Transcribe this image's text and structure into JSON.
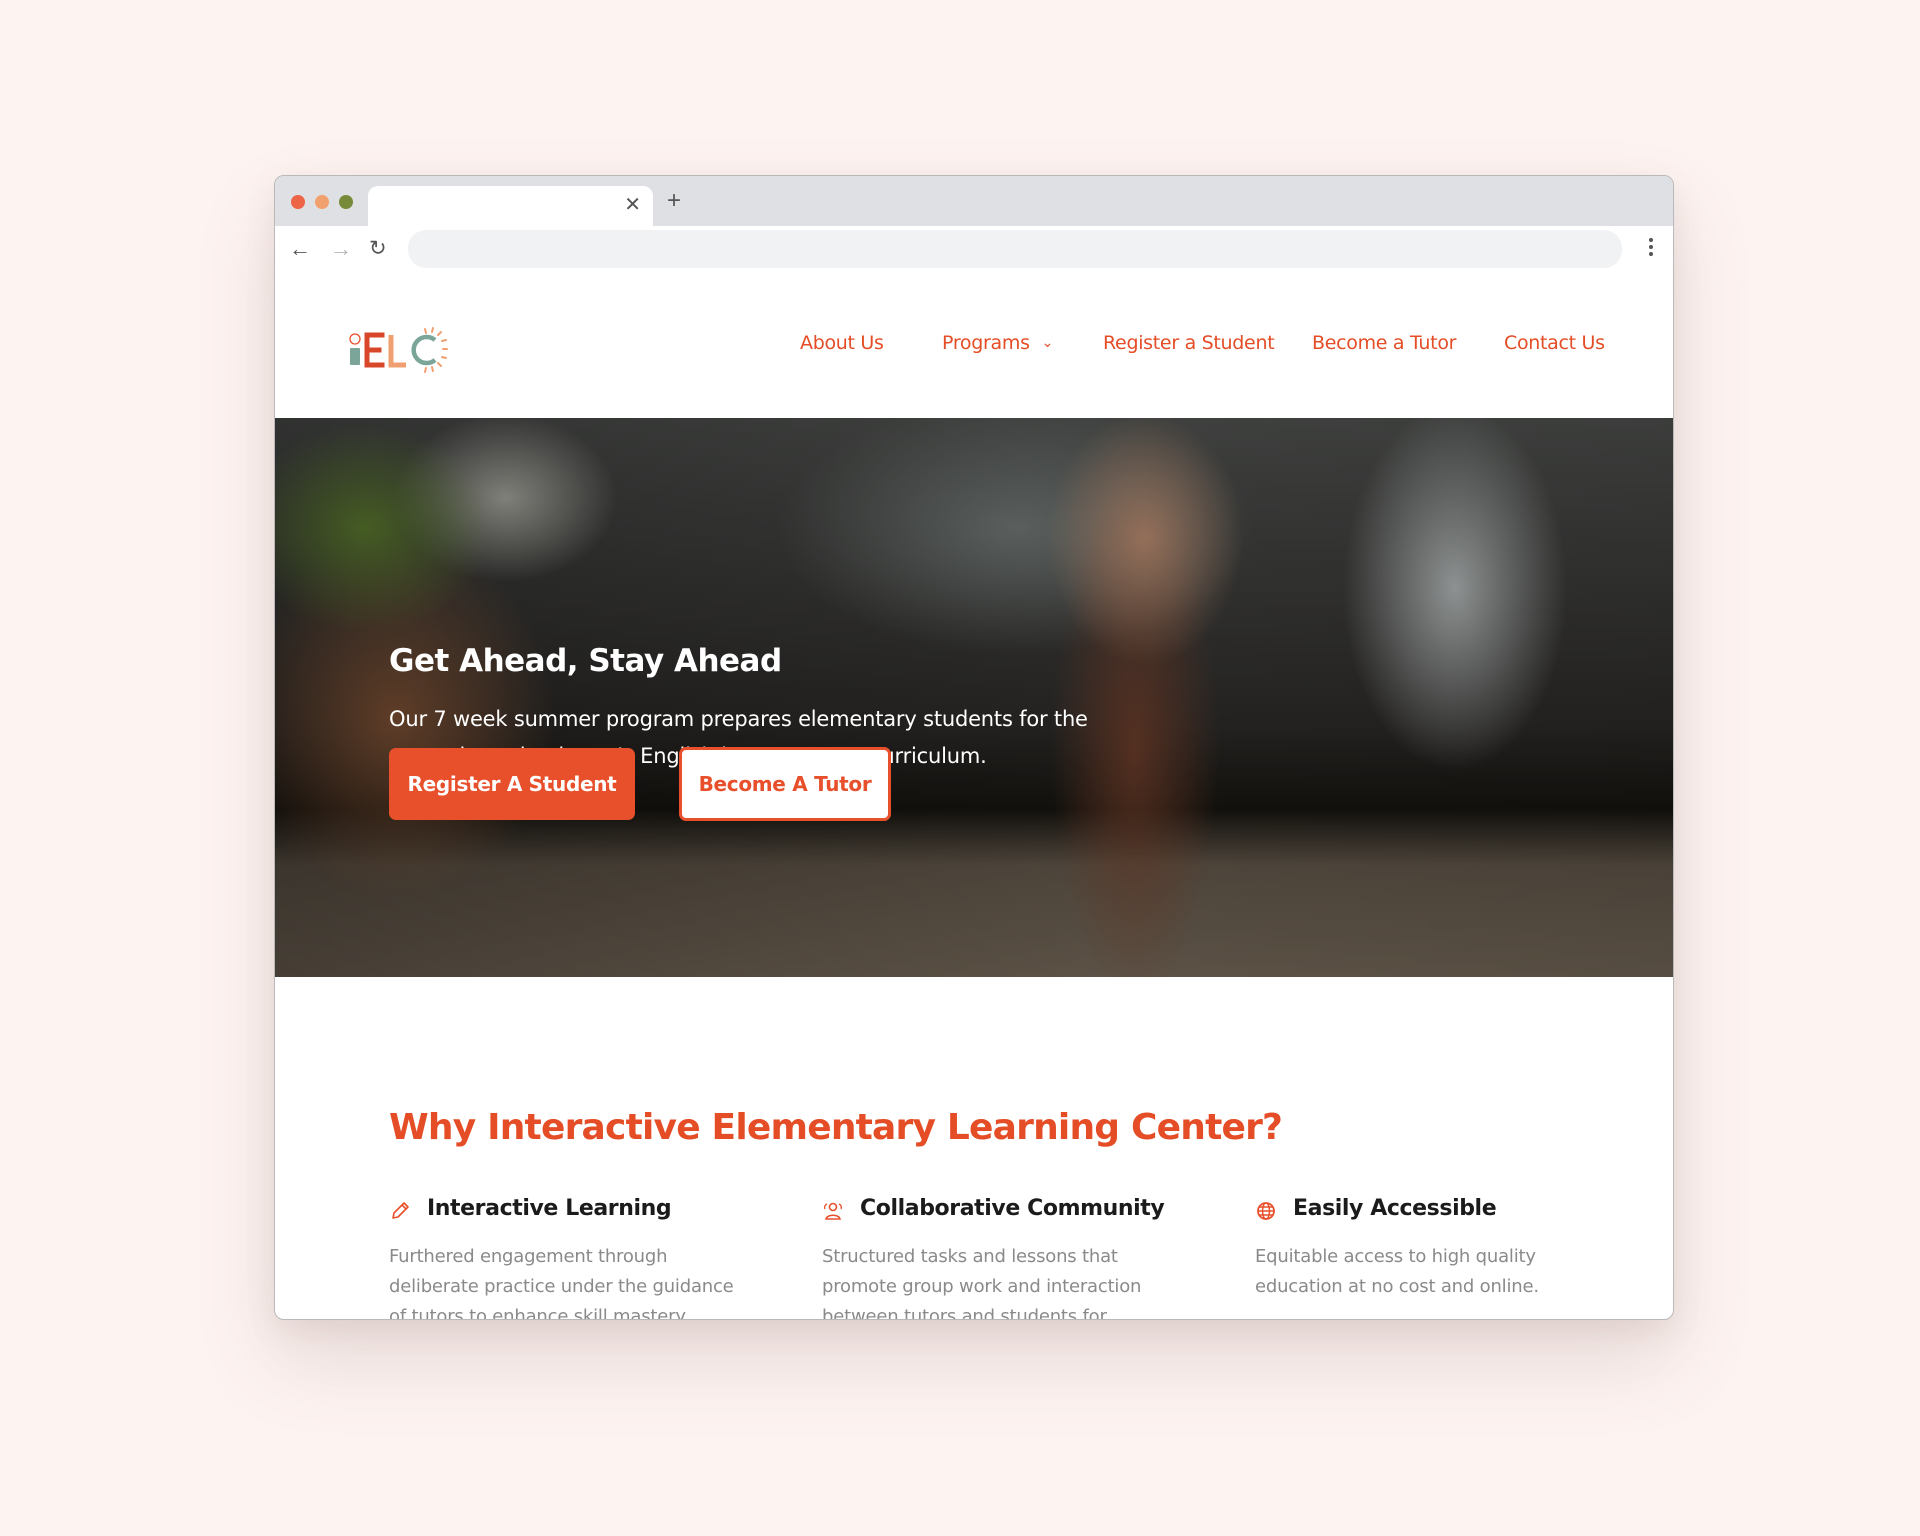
{
  "browser": {
    "tab": {
      "title": "",
      "close_icon": "close-icon"
    },
    "new_tab_icon": "plus-icon",
    "nav": {
      "back_icon": "arrow-left-icon",
      "forward_icon": "arrow-right-icon",
      "reload_icon": "reload-icon"
    },
    "address_bar": {
      "value": "",
      "placeholder": ""
    },
    "menu_icon": "kebab-menu-icon",
    "window_controls": [
      "close",
      "minimize",
      "maximize"
    ]
  },
  "site": {
    "logo": {
      "text": "iELC",
      "alt": "Interactive Elementary Learning Center logo"
    },
    "nav": [
      {
        "label": "About Us"
      },
      {
        "label": "Programs",
        "has_dropdown": true,
        "chevron": "⌄"
      },
      {
        "label": "Register a Student"
      },
      {
        "label": "Become a Tutor"
      },
      {
        "label": "Contact Us"
      }
    ]
  },
  "hero": {
    "title": "Get Ahead, Stay Ahead",
    "subtitle": "Our 7 week summer program prepares elementary students for the upcoming school year’s English language arts curriculum.",
    "primary_button": "Register A Student",
    "secondary_button": "Become A Tutor"
  },
  "why": {
    "title": "Why Interactive Elementary Learning Center?",
    "features": [
      {
        "icon": "pencil-icon",
        "title": "Interactive Learning",
        "text": "Furthered engagement through deliberate practice under the guidance of tutors to enhance skill mastery."
      },
      {
        "icon": "users-icon",
        "title": "Collaborative Community",
        "text": "Structured tasks and lessons that promote group work and interaction between tutors and students for"
      },
      {
        "icon": "globe-icon",
        "title": "Easily Accessible",
        "text": "Equitable access to high quality education at no cost and online."
      }
    ]
  },
  "colors": {
    "accent": "#e8502b",
    "nav_text": "#e44d26",
    "page_background": "#fdf3f1",
    "heading_dark": "#1b1b1b",
    "body_gray": "#8a8a8a",
    "logo_teal": "#7ca59a",
    "logo_red": "#d9472b",
    "logo_orange": "#f0a070"
  }
}
